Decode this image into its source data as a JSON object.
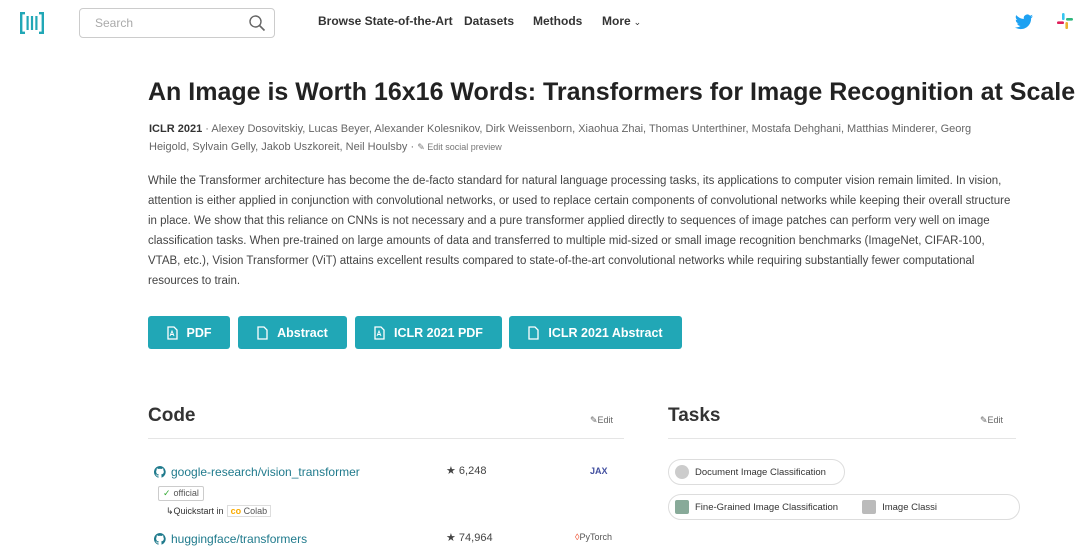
{
  "header": {
    "search_placeholder": "Search",
    "nav": [
      "Browse State-of-the-Art",
      "Datasets",
      "Methods",
      "More"
    ]
  },
  "paper": {
    "title": "An Image is Worth 16x16 Words: Transformers for Image Recognition at Scale",
    "conference": "ICLR 2021",
    "authors": "Alexey Dosovitskiy, Lucas Beyer, Alexander Kolesnikov, Dirk Weissenborn, Xiaohua Zhai, Thomas Unterthiner, Mostafa Dehghani, Matthias Minderer, Georg Heigold, Sylvain Gelly, Jakob Uszkoreit, Neil Houlsby",
    "edit_social": "Edit social preview",
    "abstract": "While the Transformer architecture has become the de-facto standard for natural language processing tasks, its applications to computer vision remain limited. In vision, attention is either applied in conjunction with convolutional networks, or used to replace certain components of convolutional networks while keeping their overall structure in place. We show that this reliance on CNNs is not necessary and a pure transformer applied directly to sequences of image patches can perform very well on image classification tasks. When pre-trained on large amounts of data and transferred to multiple mid-sized or small image recognition benchmarks (ImageNet, CIFAR-100, VTAB, etc.), Vision Transformer (ViT) attains excellent results compared to state-of-the-art convolutional networks while requiring substantially fewer computational resources to train.",
    "buttons": [
      "PDF",
      "Abstract",
      "ICLR 2021 PDF",
      "ICLR 2021 Abstract"
    ],
    "button_color": "#21a7b6"
  },
  "code": {
    "heading": "Code",
    "edit": "Edit",
    "repos": [
      {
        "name": "google-research/vision_transformer",
        "stars": "6,248",
        "official": "official",
        "quickstart": "Quickstart in",
        "colab": "Colab",
        "framework": "JAX"
      },
      {
        "name": "huggingface/transformers",
        "stars": "74,964",
        "framework": "PyTorch"
      }
    ]
  },
  "tasks": {
    "heading": "Tasks",
    "edit": "Edit",
    "items": [
      "Document Image Classification",
      "Fine-Grained Image Classification",
      "Image Classi"
    ]
  }
}
